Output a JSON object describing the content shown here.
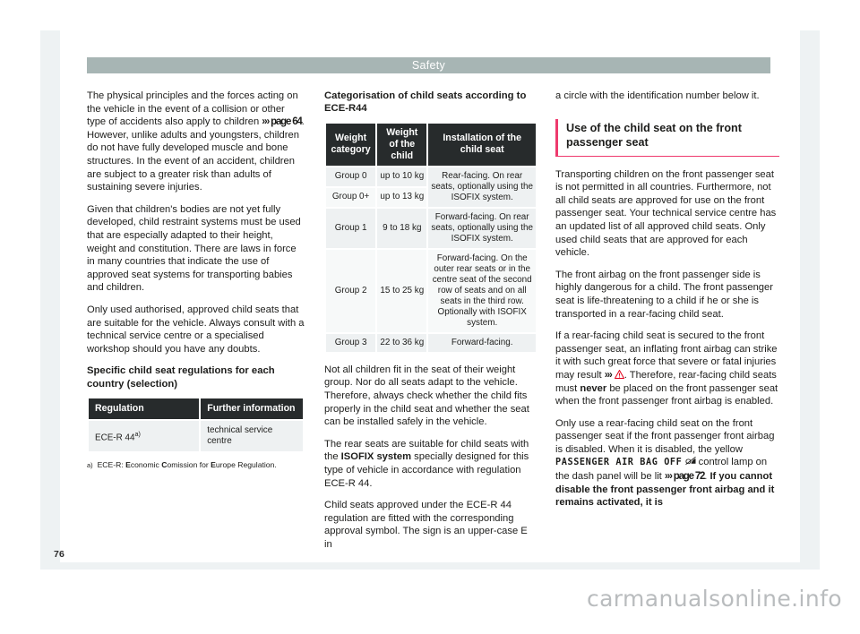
{
  "header": {
    "title": "Safety"
  },
  "page_number": "76",
  "watermark": "carmanualsonline.info",
  "column_left": {
    "p1_a": "The physical principles and the forces acting on the vehicle in the event of a collision or other type of accidents also apply to children ",
    "p1_ref": "››› page 64",
    "p1_b": ". However, unlike adults and youngsters, children do not have fully developed muscle and bone structures. In the event of an accident, children are subject to a greater risk than adults of sustaining severe injuries.",
    "p2": "Given that children's bodies are not yet fully developed, child restraint systems must be used that are especially adapted to their height, weight and constitution. There are laws in force in many countries that indicate the use of approved seat systems for transporting babies and children.",
    "p3": "Only used authorised, approved child seats that are suitable for the vehicle. Always consult with a technical service centre or a specialised workshop should you have any doubts.",
    "heading": "Specific child seat regulations for each country (selection)",
    "table": {
      "headers": [
        "Regulation",
        "Further information"
      ],
      "rows": [
        {
          "regulation": "ECE-R 44",
          "marker": "a)",
          "info": "technical service centre"
        }
      ],
      "footnote_marker": "a)",
      "footnote_parts": [
        "ECE-R: ",
        "E",
        "conomic ",
        "C",
        "omission for ",
        "E",
        "urope Regulation."
      ]
    }
  },
  "column_middle": {
    "heading": "Categorisation of child seats according to ECE-R44",
    "table": {
      "headers": [
        "Weight category",
        "Weight of the child",
        "Installation of the child seat"
      ],
      "rows": [
        {
          "group": "Group 0",
          "weight": "up to 10 kg",
          "install": "Rear-facing. On rear seats, optionally using the ISOFIX system."
        },
        {
          "group": "Group 0+",
          "weight": "up to 13 kg",
          "install": ""
        },
        {
          "group": "Group 1",
          "weight": "9 to 18 kg",
          "install": "Forward-facing. On rear seats, optionally using the ISOFIX system."
        },
        {
          "group": "Group 2",
          "weight": "15 to 25 kg",
          "install": "Forward-facing. On the outer rear seats or in the centre seat of the second row of seats and on all seats in the third row. Optionally with ISOFIX system."
        },
        {
          "group": "Group 3",
          "weight": "22 to 36 kg",
          "install": "Forward-facing."
        }
      ]
    },
    "p1": "Not all children fit in the seat of their weight group. Nor do all seats adapt to the vehicle. Therefore, always check whether the child fits properly in the child seat and whether the seat can be installed safely in the vehicle.",
    "p2_a": "The rear seats are suitable for child seats with the ",
    "p2_bold": "ISOFIX system",
    "p2_b": " specially designed for this type of vehicle in accordance with regulation ECE-R 44.",
    "p3": "Child seats approved under the ECE-R 44 regulation are fitted with the corresponding approval symbol. The sign is an upper-case E in"
  },
  "column_right": {
    "p0": "a circle with the identification number below it.",
    "section_heading": "Use of the child seat on the front passenger seat",
    "p1": "Transporting children on the front passenger seat is not permitted in all countries. Furthermore, not all child seats are approved for use on the front passenger seat. Your technical service centre has an updated list of all approved child seats. Only used child seats that are approved for each vehicle.",
    "p2": "The front airbag on the front passenger side is highly dangerous for a child. The front passenger seat is life-threatening to a child if he or she is transported in a rear-facing child seat.",
    "p3_a": "If a rear-facing child seat is secured to the front passenger seat, an inflating front airbag can strike it with such great force that severe or fatal injuries may result ",
    "p3_ref": "›››",
    "p3_warn_icon": "warning-triangle",
    "p3_b": ". Therefore, rear-facing child seats must ",
    "p3_bold": "never",
    "p3_c": " be placed on the front passenger seat when the front passenger front airbag is enabled.",
    "p4_a": "Only use a rear-facing child seat on the front passenger seat if the front passenger front airbag is disabled. When it is disabled, the yellow ",
    "p4_indicator": "PASSENGER AIR BAG OFF",
    "p4_glyph": "airbag-off-icon",
    "p4_b": " control lamp on the dash panel will be lit ",
    "p4_ref": "››› page 72",
    "p4_c": ". ",
    "p4_bold": "If you cannot disable the front passenger front airbag and it remains activated, it is"
  },
  "colors": {
    "header_band": "#a7b5b4",
    "table_header": "#272b2c",
    "table_cell": "#eef1f2",
    "accent_pink": "#ee3a6d",
    "warning_red": "#e2001a",
    "page_bg": "#eef2f3",
    "watermark": "#b9bcbe"
  }
}
